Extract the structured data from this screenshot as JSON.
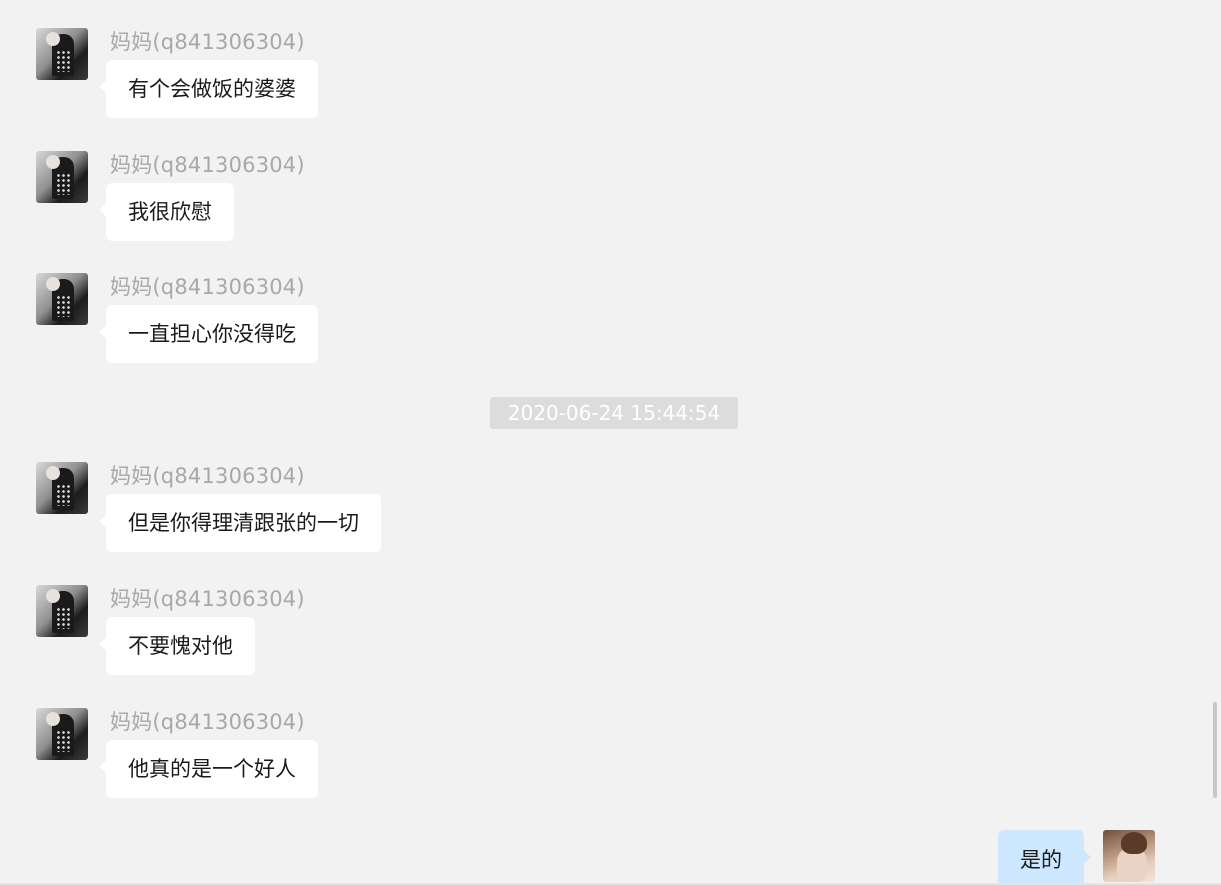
{
  "chat": {
    "timestamp": "2020-06-24 15:44:54",
    "messages": [
      {
        "sender": "妈妈(q841306304)",
        "text": "有个会做饭的婆婆"
      },
      {
        "sender": "妈妈(q841306304)",
        "text": "我很欣慰"
      },
      {
        "sender": "妈妈(q841306304)",
        "text": "一直担心你没得吃"
      },
      {
        "sender": "妈妈(q841306304)",
        "text": "但是你得理清跟张的一切"
      },
      {
        "sender": "妈妈(q841306304)",
        "text": "不要愧对他"
      },
      {
        "sender": "妈妈(q841306304)",
        "text": "他真的是一个好人"
      }
    ],
    "self_message": {
      "text": "是的"
    }
  },
  "colors": {
    "background": "#f3f2f3",
    "incoming_bubble": "#ffffff",
    "outgoing_bubble": "#cde7ff",
    "timestamp_bg": "#dcdcdc",
    "sender_text": "#a8a8a8"
  }
}
